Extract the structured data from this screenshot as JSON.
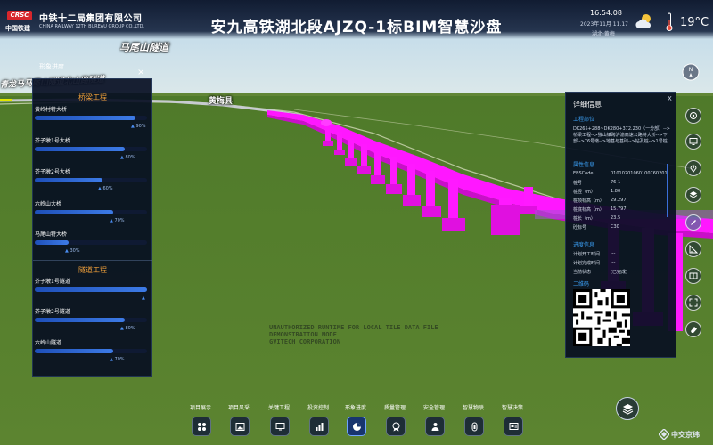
{
  "header": {
    "logo_text": "CRSC",
    "logo_subtitle": "中国铁建",
    "company_name": "中铁十二局集团有限公司",
    "company_name_en": "CHINA RAILWAY 12TH BUREAU GROUP CO.,LTD.",
    "title": "安九高铁湖北段AJZQ-1标BIM智慧沙盘",
    "time": "16:54:08",
    "date": "2023年11月 11.17",
    "location": "湖北·黄梅",
    "temperature": "19°C",
    "weather_icon": "cloud-sun-icon"
  },
  "scene": {
    "tunnel_label_top": "马尾山隧道",
    "tunnel_label_left": "青龙马马尾山隧道北山路隧道",
    "county_label": "黄梅县",
    "watermark": [
      "UNAUTHORIZED RUNTIME FOR LOCAL TILE DATA FILE",
      "DEMONSTRATION MODE",
      "GVITECH CORPORATION"
    ],
    "colors": {
      "ground": "#5a7e2c",
      "sky": "#cfe3f0",
      "bridge": "#ff19ff"
    }
  },
  "left_panel": {
    "tag": "形象进度",
    "close_icon": "×",
    "bridge_section_title": "桥梁工程",
    "tunnel_section_title": "隧道工程",
    "bridges": [
      {
        "name": "黄岭村特大桥",
        "percent": 90,
        "percent_label": "90%"
      },
      {
        "name": "芥子墩1号大桥",
        "percent": 80,
        "percent_label": "80%"
      },
      {
        "name": "芥子墩2号大桥",
        "percent": 60,
        "percent_label": "60%"
      },
      {
        "name": "六岭山大桥",
        "percent": 70,
        "percent_label": "70%"
      },
      {
        "name": "马尾山特大桥",
        "percent": 30,
        "percent_label": "30%"
      }
    ],
    "tunnels": [
      {
        "name": "芥子墩1号隧道",
        "percent": 100,
        "percent_label": ""
      },
      {
        "name": "芥子墩2号隧道",
        "percent": 80,
        "percent_label": "80%"
      },
      {
        "name": "六岭山隧道",
        "percent": 70,
        "percent_label": "70%"
      }
    ]
  },
  "detail_panel": {
    "title": "详细信息",
    "close_icon": "X",
    "section_location": "工程部位",
    "location_path": "DK265+288~DK280+372.230（一分部）-->桥梁工程-->独山镇跨沪渝高速公路特大桥-->下部-->76号墩-->地基与基础-->钻孔桩-->1号桩",
    "section_attributes": "属性信息",
    "attributes": [
      {
        "key": "EBSCode",
        "value": "01010201060100760201"
      },
      {
        "key": "桩号",
        "value": "76-1"
      },
      {
        "key": "桩径（m）",
        "value": "1.80"
      },
      {
        "key": "桩顶标高（m）",
        "value": "29.297"
      },
      {
        "key": "桩底标高（m）",
        "value": "15.797"
      },
      {
        "key": "桩长（m）",
        "value": "23.5"
      },
      {
        "key": "砼标号",
        "value": "C30"
      }
    ],
    "section_progress": "进度信息",
    "progress": [
      {
        "key": "计划开工时间",
        "value": "---"
      },
      {
        "key": "计划完成时间",
        "value": "---"
      },
      {
        "key": "当前状态",
        "value": "(已完成)"
      }
    ],
    "section_qr": "二维码"
  },
  "toolbar": {
    "compass_label": "N",
    "tools": [
      "target-icon",
      "monitor-icon",
      "location-pin-icon",
      "layers-icon",
      "pen-icon",
      "measure-icon",
      "split-view-icon",
      "fullscreen-icon",
      "eraser-icon"
    ]
  },
  "bottom_nav": {
    "items": [
      {
        "label": "项目展示",
        "icon": "grid-icon",
        "active": false
      },
      {
        "label": "项目风采",
        "icon": "image-icon",
        "active": false
      },
      {
        "label": "关键工程",
        "icon": "monitor-icon",
        "active": false
      },
      {
        "label": "投资控制",
        "icon": "bar-chart-icon",
        "active": false
      },
      {
        "label": "形象进度",
        "icon": "pie-chart-icon",
        "active": true
      },
      {
        "label": "质量管理",
        "icon": "quality-badge-icon",
        "active": false
      },
      {
        "label": "安全管理",
        "icon": "worker-icon",
        "active": false
      },
      {
        "label": "智慧物联",
        "icon": "iot-chip-icon",
        "active": false
      },
      {
        "label": "智慧决策",
        "icon": "decision-screen-icon",
        "active": false
      }
    ]
  },
  "brand": {
    "text": "中交京纬"
  }
}
